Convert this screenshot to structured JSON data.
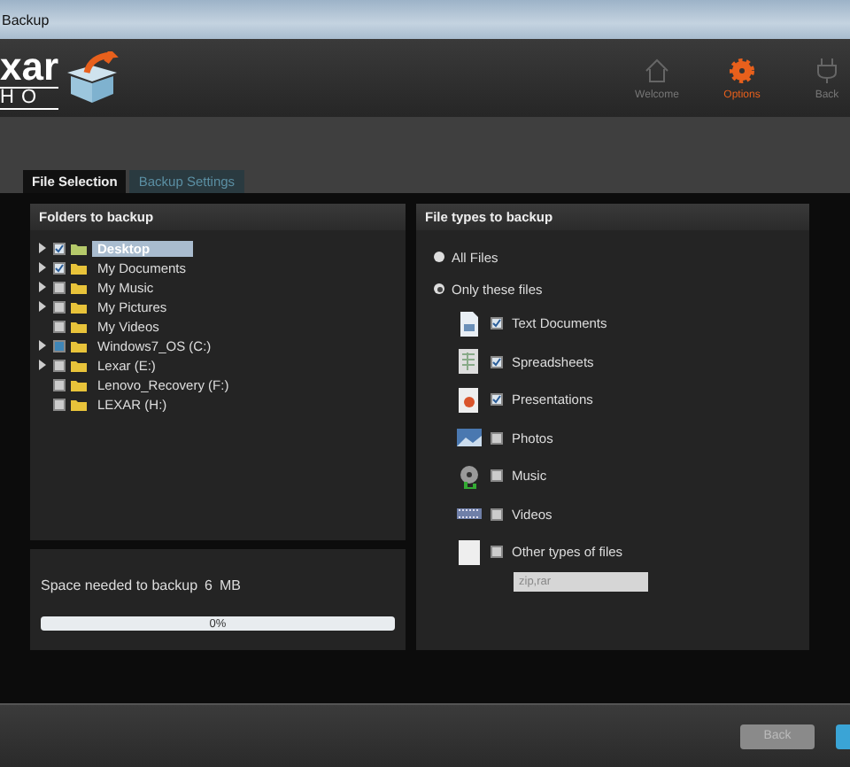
{
  "window": {
    "title": "Backup"
  },
  "logo": {
    "line_1": "xar",
    "line_2": "HO"
  },
  "nav": [
    {
      "label": "Welcome",
      "kind": "home",
      "selected": false
    },
    {
      "label": "Options",
      "kind": "gear",
      "selected": true
    },
    {
      "label": "Back",
      "kind": "plug",
      "selected": false
    }
  ],
  "tabs": [
    {
      "label": "File Selection",
      "selected": true
    },
    {
      "label": "Backup Settings",
      "selected": false
    }
  ],
  "folders": {
    "title": "Folders to backup",
    "items": [
      {
        "label": "Desktop",
        "expandable": true,
        "checked": true,
        "partial": false,
        "selected": true
      },
      {
        "label": "My Documents",
        "expandable": true,
        "checked": true,
        "partial": false,
        "selected": false
      },
      {
        "label": "My Music",
        "expandable": true,
        "checked": false,
        "partial": false,
        "selected": false
      },
      {
        "label": "My Pictures",
        "expandable": true,
        "checked": false,
        "partial": false,
        "selected": false
      },
      {
        "label": "My Videos",
        "expandable": false,
        "checked": false,
        "partial": false,
        "selected": false
      },
      {
        "label": "Windows7_OS (C:)",
        "expandable": true,
        "checked": false,
        "partial": true,
        "selected": false
      },
      {
        "label": "Lexar (E:)",
        "expandable": true,
        "checked": false,
        "partial": false,
        "selected": false
      },
      {
        "label": "Lenovo_Recovery (F:)",
        "expandable": false,
        "checked": false,
        "partial": false,
        "selected": false
      },
      {
        "label": "LEXAR (H:)",
        "expandable": false,
        "checked": false,
        "partial": false,
        "selected": false
      }
    ]
  },
  "space": {
    "label": "Space needed to backup",
    "amount": "6",
    "unit": "MB",
    "progress": {
      "level": 0,
      "text": "0%"
    }
  },
  "file_types": {
    "title": "File types to backup",
    "modes": [
      {
        "label": "All Files",
        "selected": false
      },
      {
        "label": "Only these files",
        "selected": true
      }
    ],
    "types": [
      {
        "label": "Text Documents",
        "kind": "document",
        "checked": true
      },
      {
        "label": "Spreadsheets",
        "kind": "spreadsheet",
        "checked": true
      },
      {
        "label": "Presentations",
        "kind": "presentation",
        "checked": true
      },
      {
        "label": "Photos",
        "kind": "photo",
        "checked": false
      },
      {
        "label": "Music",
        "kind": "music",
        "checked": false
      },
      {
        "label": "Videos",
        "kind": "video",
        "checked": false
      },
      {
        "label": "Other types of files",
        "kind": "other",
        "checked": false
      }
    ],
    "other_field": {
      "placeholder": "zip,rar",
      "disabled": true
    }
  },
  "footer": {
    "back_button": {
      "label": "Back",
      "disabled": true
    }
  }
}
